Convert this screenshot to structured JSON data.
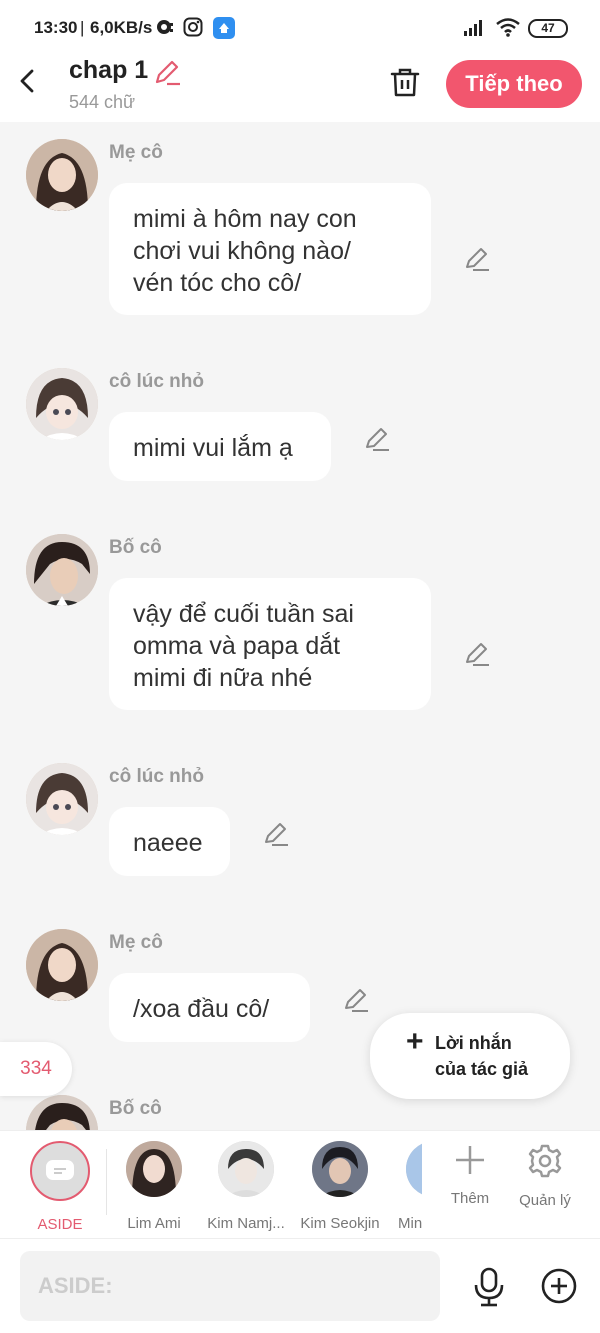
{
  "status_bar": {
    "time": "13:30",
    "separator": "|",
    "net_speed": "6,0KB/s",
    "battery": "47"
  },
  "header": {
    "title": "chap 1",
    "word_count": "544 chữ",
    "next_label": "Tiếp theo"
  },
  "messages": [
    {
      "name": "Mẹ cô",
      "lines": [
        "mimi à hôm nay con",
        "chơi vui không nào/",
        "vén tóc cho cô/"
      ]
    },
    {
      "name": "cô lúc nhỏ",
      "lines": [
        "mimi vui lắm ạ"
      ]
    },
    {
      "name": "Bố cô",
      "lines": [
        "vậy để cuối tuần sai",
        "omma và papa dắt",
        "mimi đi nữa nhé"
      ]
    },
    {
      "name": "cô lúc nhỏ",
      "lines": [
        "naeee"
      ]
    },
    {
      "name": "Mẹ cô",
      "lines": [
        "/xoa đầu cô/"
      ]
    },
    {
      "name": "Bố cô",
      "lines": []
    }
  ],
  "author_note": {
    "line1": "Lời nhắn",
    "line2": "của tác giả"
  },
  "count_badge": "334",
  "characters": [
    {
      "label": "ASIDE"
    },
    {
      "label": "Lim Ami"
    },
    {
      "label": "Kim Namj..."
    },
    {
      "label": "Kim Seokjin"
    },
    {
      "label": "Min"
    }
  ],
  "tools": {
    "add_label": "Thêm",
    "manage_label": "Quản lý"
  },
  "input": {
    "placeholder": "ASIDE:"
  },
  "colors": {
    "accent": "#f2566e",
    "accent_text": "#e35b70"
  }
}
